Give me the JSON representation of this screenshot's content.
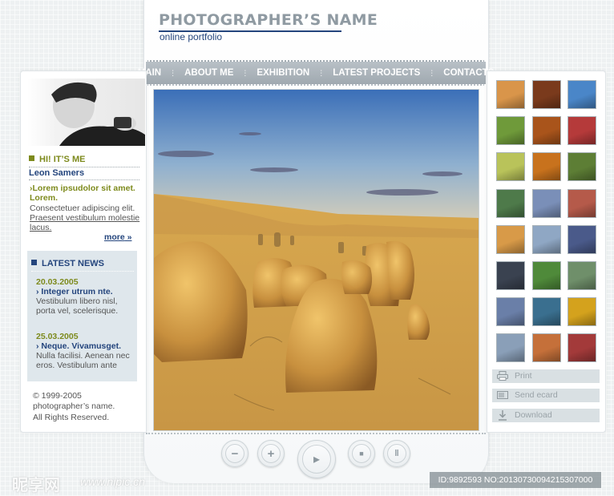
{
  "header": {
    "title": "PHOTOGRAPHER’S NAME",
    "subtitle": "online portfolio"
  },
  "nav": [
    "MAIN",
    "ABOUT ME",
    "EXHIBITION",
    "LATEST PROJECTS",
    "CONTACTS"
  ],
  "about": {
    "heading": "HI! IT’S ME",
    "name": "Leon Samers",
    "lead": "Lorem ipsudolor sit amet. Lorem.",
    "body_plain": "Consectetuer adipiscing elit.",
    "body_link": "Praesent vestibulum molestie lacus.",
    "more": "more"
  },
  "news": {
    "heading": "LATEST NEWS",
    "items": [
      {
        "date": "20.03.2005",
        "title": "Integer utrum nte.",
        "text": "Vestibulum libero nisl, porta vel, scelerisque."
      },
      {
        "date": "25.03.2005",
        "title": "Neque. Vivamusget.",
        "text": "Nulla facilisi. Aenean nec eros. Vestibulum ante"
      }
    ]
  },
  "footer": {
    "line1": "© 1999-2005",
    "line2": "photographer’s name.",
    "line3": "All Rights Reserved."
  },
  "actions": {
    "print": "Print",
    "send_ecard": "Send ecard",
    "download": "Download"
  },
  "controls": {
    "zoom_out": "−",
    "zoom_in": "+",
    "play": "▸",
    "stop": "■",
    "pause": "‖"
  },
  "thumbnail_colors": [
    "#d9954a",
    "#7a3a1c",
    "#4a86c8",
    "#6f9a3a",
    "#a9541b",
    "#b53a3a",
    "#b9c35a",
    "#c8721d",
    "#5d7e35",
    "#4e7a4a",
    "#7a8fb8",
    "#b55a4a",
    "#d89a48",
    "#8fa7c4",
    "#4a5a8a",
    "#3a4250",
    "#4f8a3a",
    "#6f8f6a",
    "#6a7fa8",
    "#3a6f8f",
    "#d4a21d",
    "#8a9fb8",
    "#c5703a",
    "#a33a3a"
  ],
  "watermark": {
    "site": "昵享网",
    "url": "www.nipic.cn",
    "id": "ID:9892593 NO:20130730094215307000"
  },
  "colors": {
    "brand_blue": "#24457d",
    "accent_olive": "#7d8a1c",
    "nav_gray": "#a8b0b6"
  }
}
